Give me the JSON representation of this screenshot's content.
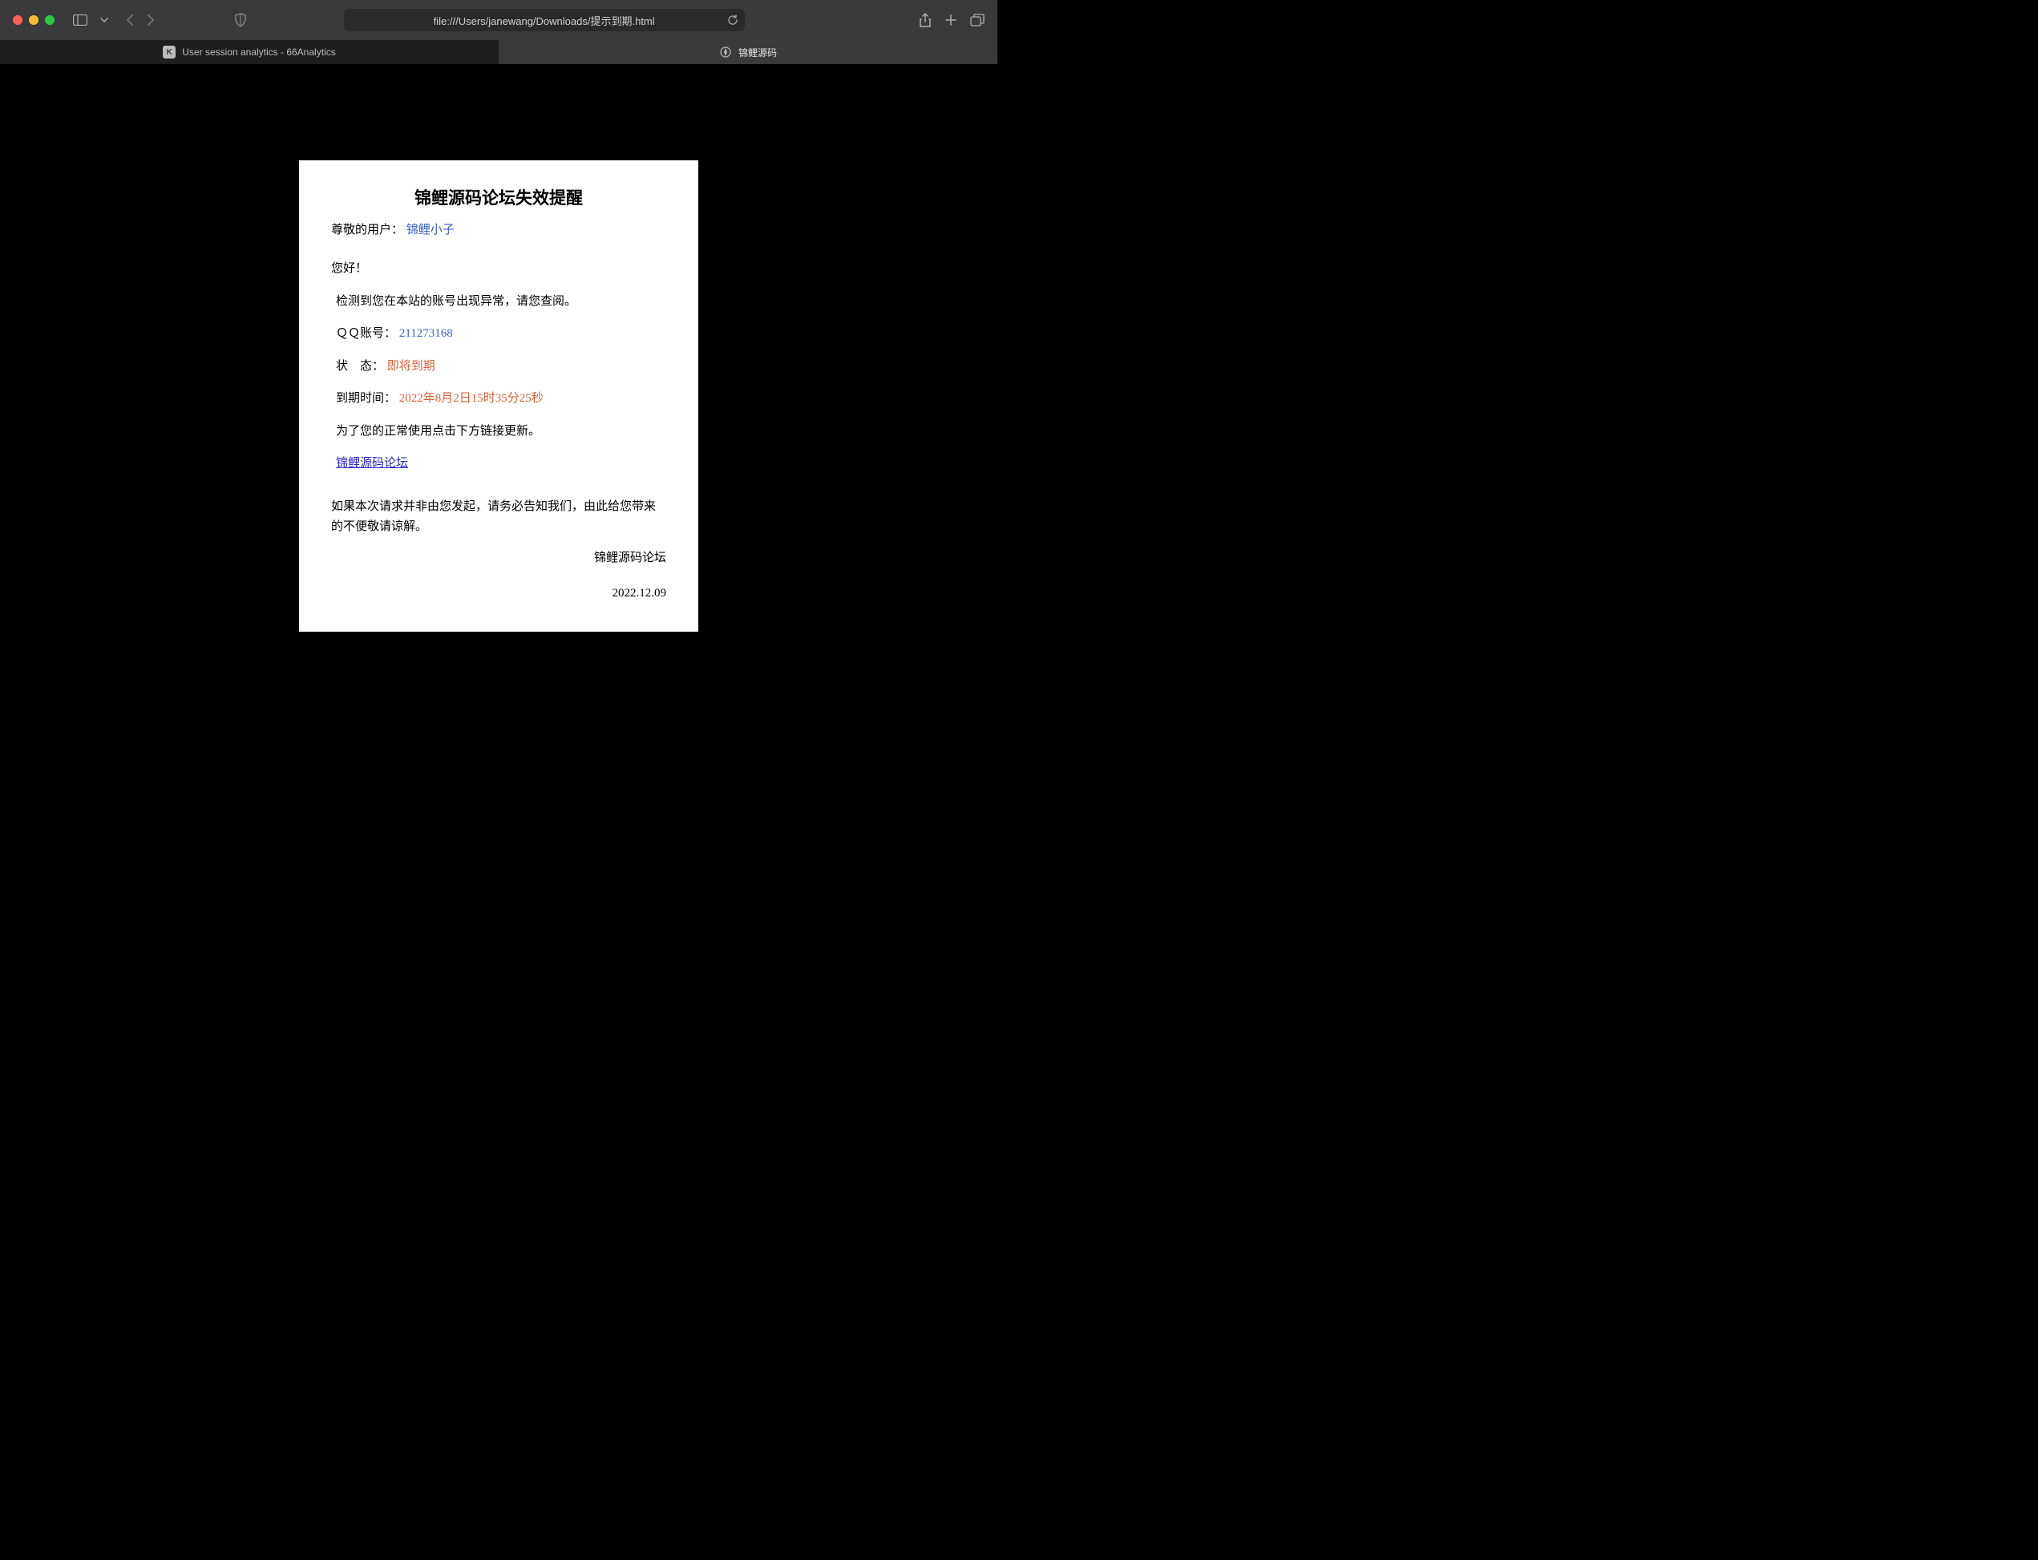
{
  "browser": {
    "url": "file:///Users/janewang/Downloads/提示到期.html",
    "tabs": [
      {
        "label": "User session analytics - 66Analytics",
        "favicon": "K"
      },
      {
        "label": "锦鲤源码",
        "favicon": "compass"
      }
    ]
  },
  "page": {
    "title": "锦鲤源码论坛失效提醒",
    "user_label": "尊敬的用户：",
    "user_name": "锦鲤小子",
    "greeting": "您好！",
    "notice": "检测到您在本站的账号出现异常，请您查阅。",
    "qq_label": "ＱＱ账号：",
    "qq_value": "211273168",
    "status_label": "状　态：",
    "status_value": "即将到期",
    "expire_label": "到期时间：",
    "expire_value": "2022年8月2日15时35分25秒",
    "instruction": "为了您的正常使用点击下方链接更新。",
    "link_text": "锦鲤源码论坛",
    "disclaimer": "如果本次请求并非由您发起，请务必告知我们，由此给您带来的不便敬请谅解。",
    "signature": "锦鲤源码论坛",
    "date": "2022.12.09"
  }
}
